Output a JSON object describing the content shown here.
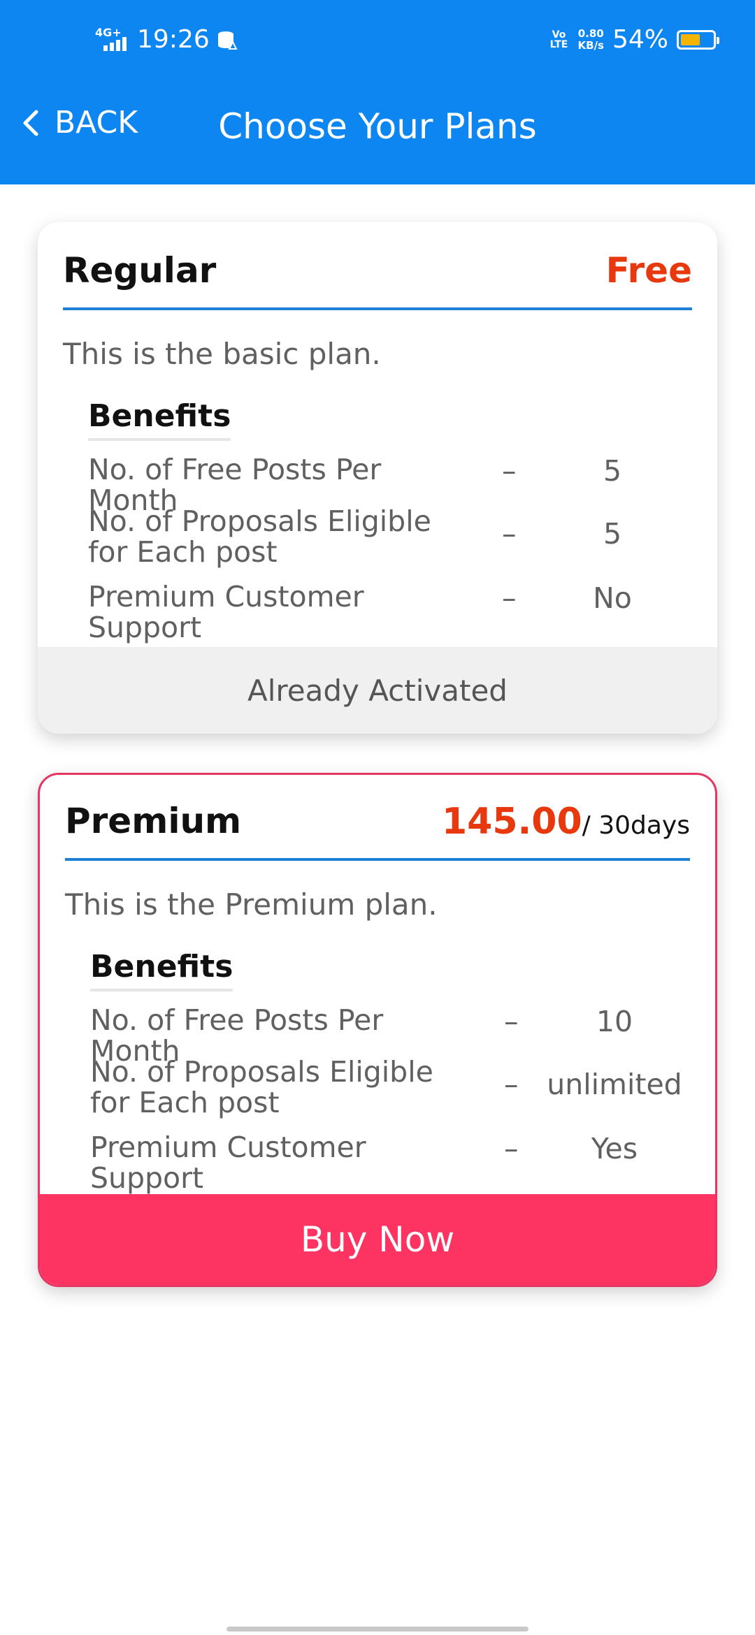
{
  "status_bar": {
    "network": "4G+",
    "time": "19:26",
    "volte": "Vo LTE",
    "speed_value": "0.80",
    "speed_unit": "KB/s",
    "battery_text": "54%",
    "battery_level": 0.54,
    "battery_color": "#f4b400"
  },
  "header": {
    "back_label": "BACK",
    "title": "Choose Your Plans",
    "background_color": "#0d86f2"
  },
  "plans": [
    {
      "name": "Regular",
      "price": "Free",
      "description": "This is the basic plan.",
      "benefits_title": "Benefits",
      "benefits": [
        {
          "label": "No. of Free Posts Per Month",
          "dash": "–",
          "value": "5"
        },
        {
          "label": "No. of Proposals Eligible for Each post",
          "dash": "–",
          "value": "5"
        },
        {
          "label": "Premium Customer Support",
          "dash": "–",
          "value": "No"
        }
      ],
      "action_label": "Already Activated"
    },
    {
      "name": "Premium",
      "price": "145.00",
      "period": "/ 30days",
      "description": "This is the Premium plan.",
      "benefits_title": "Benefits",
      "benefits": [
        {
          "label": "No. of Free Posts Per Month",
          "dash": "–",
          "value": "10"
        },
        {
          "label": "No. of Proposals Eligible for Each post",
          "dash": "–",
          "value": "unlimited"
        },
        {
          "label": "Premium Customer Support",
          "dash": "–",
          "value": "Yes"
        }
      ],
      "action_label": "Buy Now",
      "accent_color": "#fd3461"
    }
  ],
  "colors": {
    "price_color": "#e8380d",
    "divider_color": "#1f7fd6"
  }
}
